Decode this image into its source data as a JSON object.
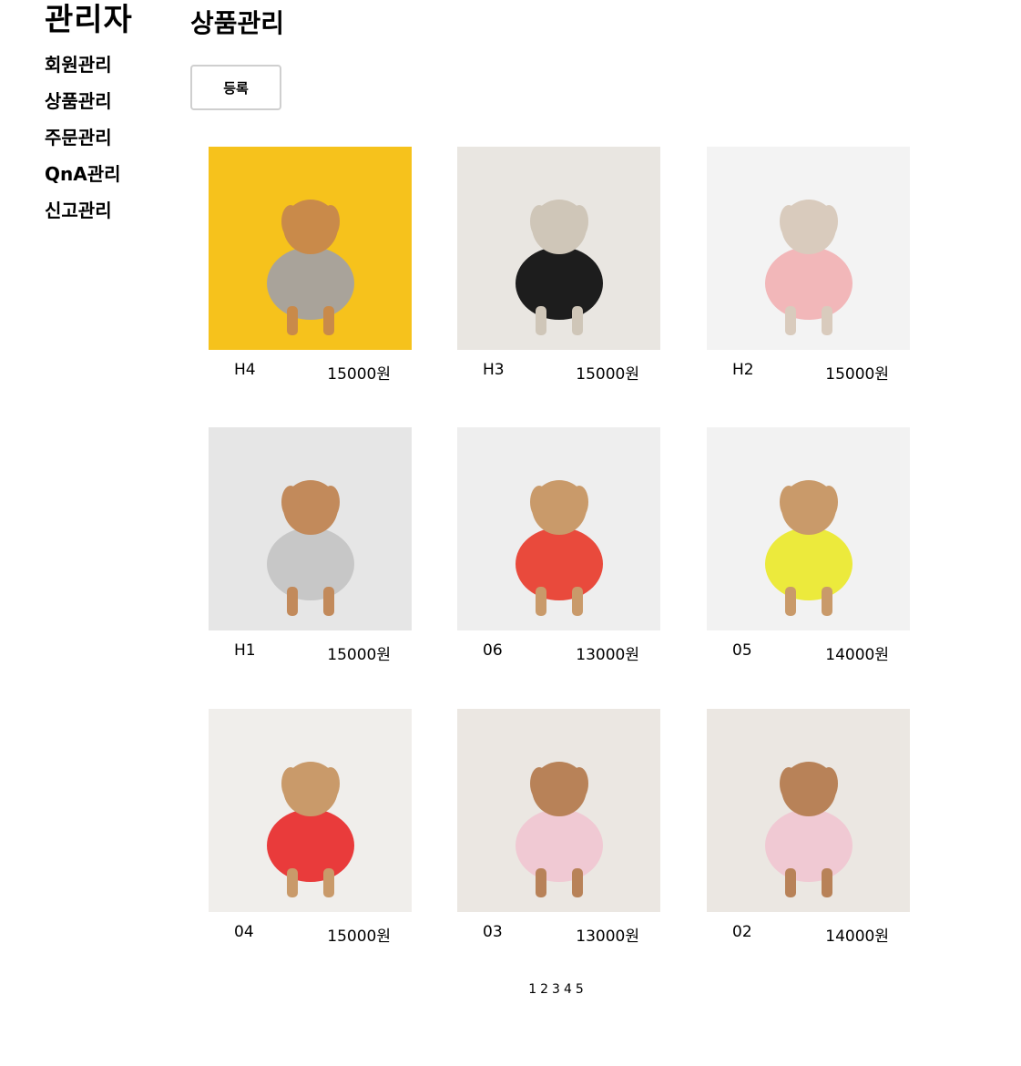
{
  "sidebar": {
    "title": "관리자",
    "items": [
      "회원관리",
      "상품관리",
      "주문관리",
      "QnA관리",
      "신고관리"
    ]
  },
  "main": {
    "title": "상품관리",
    "register_label": "등록"
  },
  "products": [
    {
      "name": "H4",
      "price": "15000원",
      "bg": "#f6c21c",
      "accent": "#a9a39a",
      "animal": "#c98a4a"
    },
    {
      "name": "H3",
      "price": "15000원",
      "bg": "#e9e6e1",
      "accent": "#1d1d1d",
      "animal": "#cfc6b8"
    },
    {
      "name": "H2",
      "price": "15000원",
      "bg": "#f3f3f3",
      "accent": "#f2b7b9",
      "animal": "#d9cbbd"
    },
    {
      "name": "H1",
      "price": "15000원",
      "bg": "#e6e6e6",
      "accent": "#c7c7c7",
      "animal": "#c28a5b"
    },
    {
      "name": "06",
      "price": "13000원",
      "bg": "#eeeeee",
      "accent": "#e94a3c",
      "animal": "#c99a6a"
    },
    {
      "name": "05",
      "price": "14000원",
      "bg": "#f2f2f2",
      "accent": "#ecea3c",
      "animal": "#c99a6a"
    },
    {
      "name": "04",
      "price": "15000원",
      "bg": "#f0eeeb",
      "accent": "#e93b3b",
      "animal": "#c99a6a"
    },
    {
      "name": "03",
      "price": "13000원",
      "bg": "#ebe7e2",
      "accent": "#f0c9d3",
      "animal": "#b88258"
    },
    {
      "name": "02",
      "price": "14000원",
      "bg": "#ebe7e2",
      "accent": "#f0c9d3",
      "animal": "#b88258"
    }
  ],
  "pagination": [
    "1",
    "2",
    "3",
    "4",
    "5"
  ]
}
